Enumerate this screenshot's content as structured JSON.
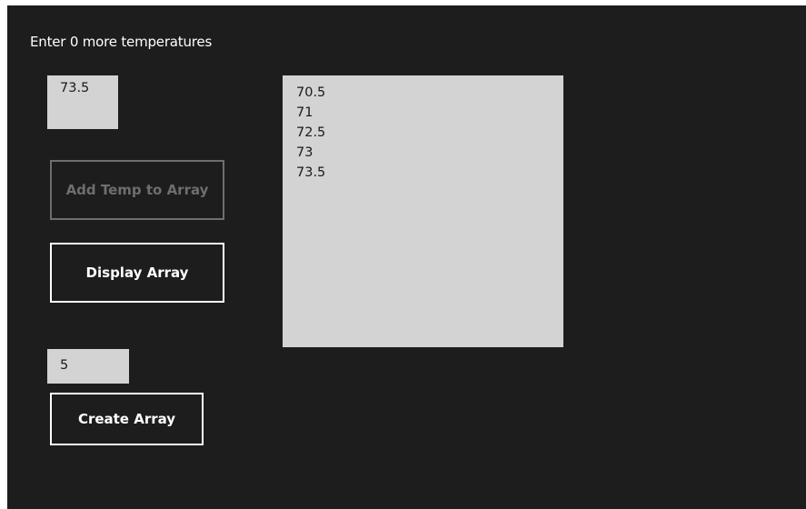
{
  "prompt": "Enter 0 more temperatures",
  "temp_input": {
    "value": "73.5"
  },
  "buttons": {
    "add": "Add Temp to Array",
    "display": "Display Array",
    "create": "Create Array"
  },
  "array_list": [
    "70.5",
    "71",
    "72.5",
    "73",
    "73.5"
  ],
  "size_input": {
    "value": "5"
  }
}
